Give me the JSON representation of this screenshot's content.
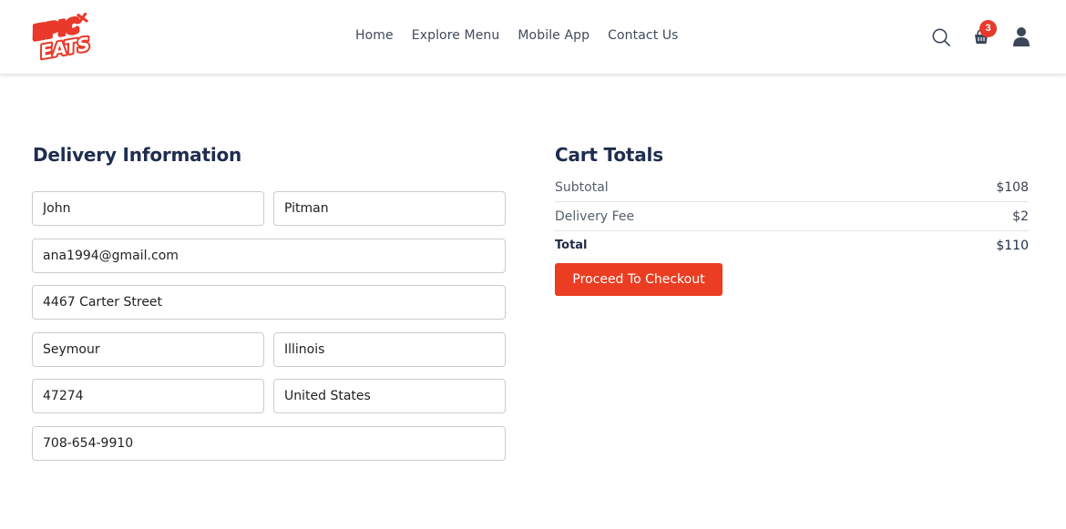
{
  "brand": {
    "logo_text_top": "EPIC",
    "logo_text_bottom": "EATS",
    "logo_color": "#e8392a"
  },
  "nav": {
    "links": [
      "Home",
      "Explore Menu",
      "Mobile App",
      "Contact Us"
    ],
    "cart_count": "3",
    "icons": [
      "search-icon",
      "cart-icon",
      "user-icon"
    ]
  },
  "delivery": {
    "title": "Delivery Information",
    "first_name": "John",
    "last_name": "Pitman",
    "email": "ana1994@gmail.com",
    "street": "4467 Carter Street",
    "city": "Seymour",
    "state": "Illinois",
    "zip": "47274",
    "country": "United States",
    "phone": "708-654-9910"
  },
  "cart": {
    "title": "Cart Totals",
    "subtotal_label": "Subtotal",
    "subtotal_value": "$108",
    "delivery_label": "Delivery Fee",
    "delivery_value": "$2",
    "total_label": "Total",
    "total_value": "$110",
    "checkout_label": "Proceed To Checkout"
  },
  "colors": {
    "accent": "#ea3d22",
    "heading": "#1f2d4e",
    "badge": "#e8392a"
  }
}
